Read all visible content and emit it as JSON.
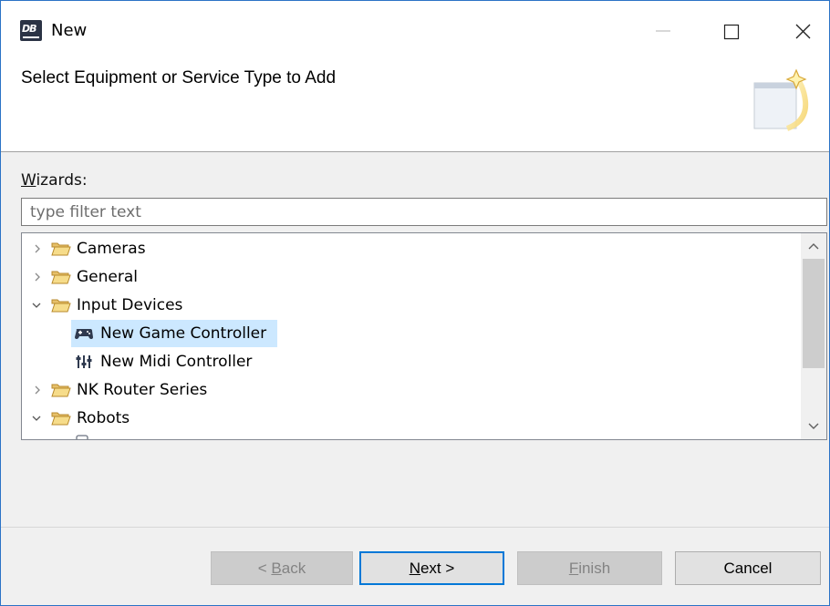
{
  "window": {
    "title": "New",
    "app_icon_text": "DB"
  },
  "banner": {
    "title": "Select Equipment or Service Type to Add"
  },
  "wizards": {
    "label_mnemonic": "W",
    "label_rest": "izards:",
    "filter_placeholder": "type filter text"
  },
  "tree": {
    "items": [
      {
        "label": "Cameras",
        "expanded": false,
        "level": 0,
        "icon": "folder-icon"
      },
      {
        "label": "General",
        "expanded": false,
        "level": 0,
        "icon": "folder-icon"
      },
      {
        "label": "Input Devices",
        "expanded": true,
        "level": 0,
        "icon": "folder-icon"
      },
      {
        "label": "New Game Controller",
        "level": 1,
        "icon": "gamepad-icon",
        "selected": true
      },
      {
        "label": "New Midi Controller",
        "level": 1,
        "icon": "midi-controller-icon"
      },
      {
        "label": "NK Router Series",
        "expanded": false,
        "level": 0,
        "icon": "folder-icon"
      },
      {
        "label": "Robots",
        "expanded": true,
        "level": 0,
        "icon": "folder-icon"
      }
    ]
  },
  "buttons": {
    "back_prefix": "< ",
    "back_mnemonic": "B",
    "back_rest": "ack",
    "next_mnemonic": "N",
    "next_rest": "ext >",
    "finish_mnemonic": "F",
    "finish_rest": "inish",
    "cancel": "Cancel"
  },
  "colors": {
    "selection": "#cce8ff",
    "default_button_border": "#0078d7",
    "window_border": "#2b73c6",
    "folder": "#dcb158"
  }
}
